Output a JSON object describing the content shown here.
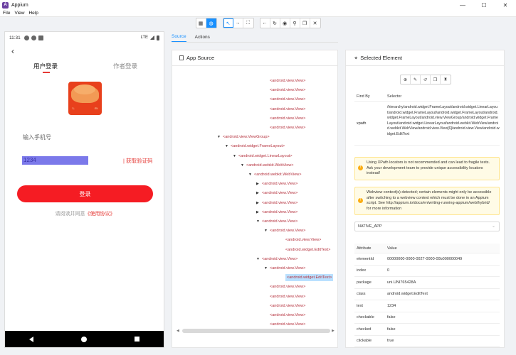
{
  "window": {
    "title": "Appium",
    "minimize": "—",
    "maximize": "☐",
    "close": "✕"
  },
  "menu": [
    "File",
    "View",
    "Help"
  ],
  "device": {
    "time": "11:31",
    "network": "LTE",
    "back": "‹",
    "tab_user_login": "用户登录",
    "tab_author_login": "作者登录",
    "logo_letters": [
      "L",
      "m"
    ],
    "phone_placeholder": "输入手机号",
    "code_value": "1234",
    "get_code": "| 获取验证码",
    "login_button": "登录",
    "agreement_prefix": "请阅读并同意",
    "agreement_link": "《使用协议》"
  },
  "middle": {
    "tabs": [
      "Source",
      "Actions"
    ],
    "source_title": "App Source",
    "tree": [
      {
        "label": "<android.view.View>",
        "indent": 0,
        "caret": ""
      },
      {
        "label": "<android.view.View>",
        "indent": 0,
        "caret": ""
      },
      {
        "label": "<android.view.View>",
        "indent": 0,
        "caret": ""
      },
      {
        "label": "<android.view.View>",
        "indent": 0,
        "caret": ""
      },
      {
        "label": "<android.view.View>",
        "indent": 0,
        "caret": ""
      },
      {
        "label": "<android.view.View>",
        "indent": 0,
        "caret": ""
      },
      {
        "label": "<android.view.ViewGroup>",
        "indent": -6,
        "caret": "▼"
      },
      {
        "label": "<android.widget.FrameLayout>",
        "indent": -5,
        "caret": "▼"
      },
      {
        "label": "<android.widget.LinearLayout>",
        "indent": -4,
        "caret": "▼"
      },
      {
        "label": "<android.webkit.WebView>",
        "indent": -3,
        "caret": "▼"
      },
      {
        "label": "<android.webkit.WebView>",
        "indent": -2,
        "caret": "▼"
      },
      {
        "label": "<android.view.View>",
        "indent": -1,
        "caret": "▶"
      },
      {
        "label": "<android.view.View>",
        "indent": -1,
        "caret": "▶"
      },
      {
        "label": "<android.view.View>",
        "indent": -1,
        "caret": "▶"
      },
      {
        "label": "<android.view.View>",
        "indent": -1,
        "caret": "▶"
      },
      {
        "label": "<android.view.View>",
        "indent": -1,
        "caret": "▼"
      },
      {
        "label": "<android.view.View>",
        "indent": 0,
        "caret": "▼"
      },
      {
        "label": "<android.view.View>",
        "indent": 2,
        "caret": ""
      },
      {
        "label": "<android.widget.EditText>",
        "indent": 2,
        "caret": ""
      },
      {
        "label": "<android.view.View>",
        "indent": -1,
        "caret": "▼"
      },
      {
        "label": "<android.view.View>",
        "indent": 0,
        "caret": "▼"
      },
      {
        "label": "<android.widget.EditText>",
        "indent": 2,
        "caret": "",
        "selected": true
      },
      {
        "label": "<android.view.View>",
        "indent": 0,
        "caret": ""
      },
      {
        "label": "<android.view.View>",
        "indent": 0,
        "caret": ""
      },
      {
        "label": "<android.view.View>",
        "indent": 0,
        "caret": ""
      },
      {
        "label": "<android.view.View>",
        "indent": 0,
        "caret": ""
      },
      {
        "label": "<android.view.View>",
        "indent": 0,
        "caret": ""
      }
    ]
  },
  "right": {
    "title": "Selected Element",
    "find_by_header": "Find By",
    "selector_header": "Selector",
    "xpath_key": "xpath",
    "xpath_value": "/hierarchy/android.widget.FrameLayout/android.widget.LinearLayout/android.widget.FrameLayout/android.widget.FrameLayout/android.widget.FrameLayout/android.view.ViewGroup/android.widget.FrameLayout/android.widget.LinearLayout/android.webkit.WebView/android.webkit.WebView/android.view.View[6]/android.view.View/android.widget.EditText",
    "xpath_warning": "Using XPath locators is not recommended and can lead to fragile tests. Ask your development team to provide unique accessibility locators instead!",
    "webview_notice": "Webview context(s) detected; certain elements might only be accessible after switching to a webview context which must be done in an Appium script. See http://appium.io/docs/en/writing-running-appium/web/hybrid/ for more information",
    "context": "NATIVE_APP",
    "attr_header_k": "Attribute",
    "attr_header_v": "Value",
    "attributes": [
      {
        "k": "elementId",
        "v": "00000000-0000-0027-0000-00b000000049"
      },
      {
        "k": "index",
        "v": "0"
      },
      {
        "k": "package",
        "v": "uni.UNI765428A"
      },
      {
        "k": "class",
        "v": "android.widget.EditText"
      },
      {
        "k": "text",
        "v": "1234"
      },
      {
        "k": "checkable",
        "v": "false"
      },
      {
        "k": "checked",
        "v": "false"
      },
      {
        "k": "clickable",
        "v": "true"
      }
    ]
  },
  "colors": {
    "accent": "#1890ff",
    "brand_red": "#f51c23",
    "tree_red": "#b5313d"
  }
}
